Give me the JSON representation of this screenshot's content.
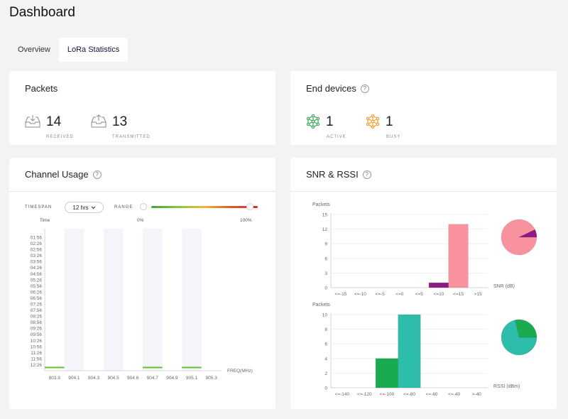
{
  "page": {
    "title": "Dashboard"
  },
  "tabs": [
    {
      "label": "Overview",
      "active": false
    },
    {
      "label": "LoRa Statistics",
      "active": true
    }
  ],
  "packets": {
    "title": "Packets",
    "received": {
      "value": "14",
      "label": "RECEIVED",
      "icon": "inbox-download-icon"
    },
    "transmitted": {
      "value": "13",
      "label": "TRANSMITTED",
      "icon": "inbox-upload-icon"
    }
  },
  "end_devices": {
    "title": "End devices",
    "help": "?",
    "active": {
      "value": "1",
      "label": "ACTIVE",
      "icon": "network-node-icon",
      "color": "#3aaa5a"
    },
    "busy": {
      "value": "1",
      "label": "BUSY",
      "icon": "network-node-icon",
      "color": "#f0a030"
    }
  },
  "channel_usage": {
    "title": "Channel Usage",
    "help": "?",
    "timespan_label": "TIMESPAN",
    "timespan_value": "12 hrs",
    "range_label": "RANGE",
    "range_min": "0%",
    "range_max": "100%",
    "time_label": "Time",
    "freq_label": "FREQ(MHz)"
  },
  "snr_rssi": {
    "title": "SNR & RSSI",
    "help": "?"
  },
  "chart_data": [
    {
      "type": "heatmap",
      "title": "Channel Usage",
      "xlabel": "FREQ(MHz)",
      "ylabel": "Time",
      "x": [
        "903.9",
        "904.1",
        "904.3",
        "904.5",
        "904.6",
        "904.7",
        "904.9",
        "905.1",
        "905.3"
      ],
      "y": [
        "01:56",
        "02:26",
        "02:56",
        "03:26",
        "03:56",
        "04:26",
        "04:56",
        "05:26",
        "05:56",
        "06:26",
        "06:56",
        "07:26",
        "07:56",
        "08:26",
        "08:56",
        "09:26",
        "09:56",
        "10:26",
        "10:56",
        "11:26",
        "11:56",
        "12:26"
      ],
      "active_cells": [
        {
          "x": "903.9",
          "y": "12:26"
        },
        {
          "x": "904.7",
          "y": "12:26"
        },
        {
          "x": "905.1",
          "y": "12:26"
        }
      ],
      "colors": {
        "active": "#6abf2e",
        "band": "#f4f5fb"
      }
    },
    {
      "type": "bar",
      "ylabel": "Packets",
      "xlabel": "SNR (dB)",
      "categories": [
        "<=-15",
        "<=-10",
        "<=-5",
        "<=0",
        "<=5",
        "<=10",
        "<=15",
        ">15"
      ],
      "values": [
        0,
        0,
        0,
        0,
        0,
        1,
        13,
        0
      ],
      "colors": [
        "#8e1a86",
        "#8e1a86",
        "#8e1a86",
        "#8e1a86",
        "#8e1a86",
        "#8e1a86",
        "#f7929e",
        "#f7929e"
      ],
      "ylim": [
        0,
        15
      ],
      "yticks": [
        0,
        3,
        6,
        9,
        12,
        15
      ]
    },
    {
      "type": "pie",
      "values": [
        13,
        1
      ],
      "colors": [
        "#f7929e",
        "#8e1a86"
      ]
    },
    {
      "type": "bar",
      "ylabel": "Packets",
      "xlabel": "RSSI (dBm)",
      "categories": [
        "<=-140",
        "<=-120",
        "<=-100",
        "<=-80",
        "<=-60",
        "<=-40",
        ">-40"
      ],
      "values": [
        0,
        0,
        4,
        10,
        0,
        0,
        0
      ],
      "colors": [
        "#1aaa50",
        "#1aaa50",
        "#1aaa50",
        "#2ebdaa",
        "#2ebdaa",
        "#2ebdaa",
        "#2ebdaa"
      ],
      "ylim": [
        0,
        10
      ],
      "yticks": [
        0,
        2,
        4,
        6,
        8,
        10
      ]
    },
    {
      "type": "pie",
      "values": [
        10,
        4
      ],
      "colors": [
        "#2ebdaa",
        "#1aaa50"
      ]
    }
  ]
}
